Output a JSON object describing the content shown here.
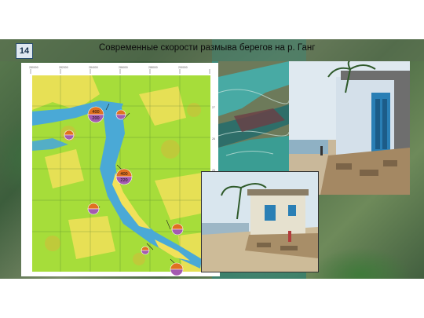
{
  "slide": {
    "number": "14",
    "title": "Современные скорости размыва берегов на р. Ганг"
  },
  "map": {
    "markers": [
      {
        "top": "400",
        "bottom": "200"
      },
      {
        "top": "",
        "bottom": ""
      },
      {
        "top": "",
        "bottom": ""
      },
      {
        "top": "400",
        "bottom": "220"
      },
      {
        "top": "",
        "bottom": ""
      },
      {
        "top": "",
        "bottom": ""
      },
      {
        "top": "",
        "bottom": ""
      },
      {
        "top": "",
        "bottom": ""
      }
    ]
  },
  "colors": {
    "water": "#4aa9d6",
    "land": "#a6dd3a",
    "sand": "#f2e15a",
    "marker_top": "#e07020",
    "marker_bottom": "#a45ab0"
  },
  "icons": [
    "palm-icon"
  ]
}
